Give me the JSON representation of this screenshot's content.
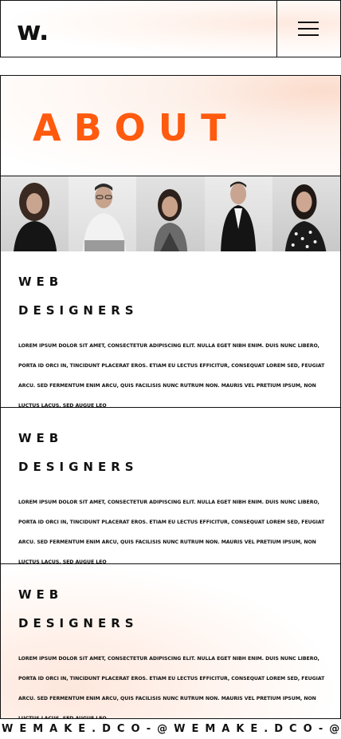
{
  "header": {
    "logo": "w.",
    "menu_icon": "hamburger-icon"
  },
  "hero": {
    "title": "ABOUT",
    "accent_color": "#ff5a0e"
  },
  "team": [
    {
      "photo": "portrait-woman-curly-hair"
    },
    {
      "photo": "portrait-man-glasses"
    },
    {
      "photo": "portrait-woman-laughing"
    },
    {
      "photo": "portrait-man-suit"
    },
    {
      "photo": "portrait-woman-dark-hair"
    }
  ],
  "sections": [
    {
      "title_line1": "WEB",
      "title_line2": "DESIGNERS",
      "body": "Lorem ipsum dolor sit amet, consectetur adipiscing elit. Nulla eget nibh enim. Duis nunc libero, porta id orci in, tincidunt placerat eros. Etiam eu lectus efficitur, consequat lorem sed, feugiat arcu. Sed fermentum enim arcu, quis facilisis nunc rutrum non. Mauris vel pretium ipsum, non luctus lacus. Sed augue leo"
    },
    {
      "title_line1": "WEB",
      "title_line2": "DESIGNERS",
      "body": "Lorem ipsum dolor sit amet, consectetur adipiscing elit. Nulla eget nibh enim. Duis nunc libero, porta id orci in, tincidunt placerat eros. Etiam eu lectus efficitur, consequat lorem sed, feugiat arcu. Sed fermentum enim arcu, quis facilisis nunc rutrum non. Mauris vel pretium ipsum, non luctus lacus. Sed augue leo"
    },
    {
      "title_line1": "WEB",
      "title_line2": "DESIGNERS",
      "body": "Lorem ipsum dolor sit amet, consectetur adipiscing elit. Nulla eget nibh enim. Duis nunc libero, porta id orci in, tincidunt placerat eros. Etiam eu lectus efficitur, consequat lorem sed, feugiat arcu. Sed fermentum enim arcu, quis facilisis nunc rutrum non. Mauris vel pretium ipsum, non luctus lacus. Sed augue leo"
    }
  ],
  "footer": {
    "marquee": "WEMAKE.DCO-@WEMAKE.DCO-@"
  }
}
